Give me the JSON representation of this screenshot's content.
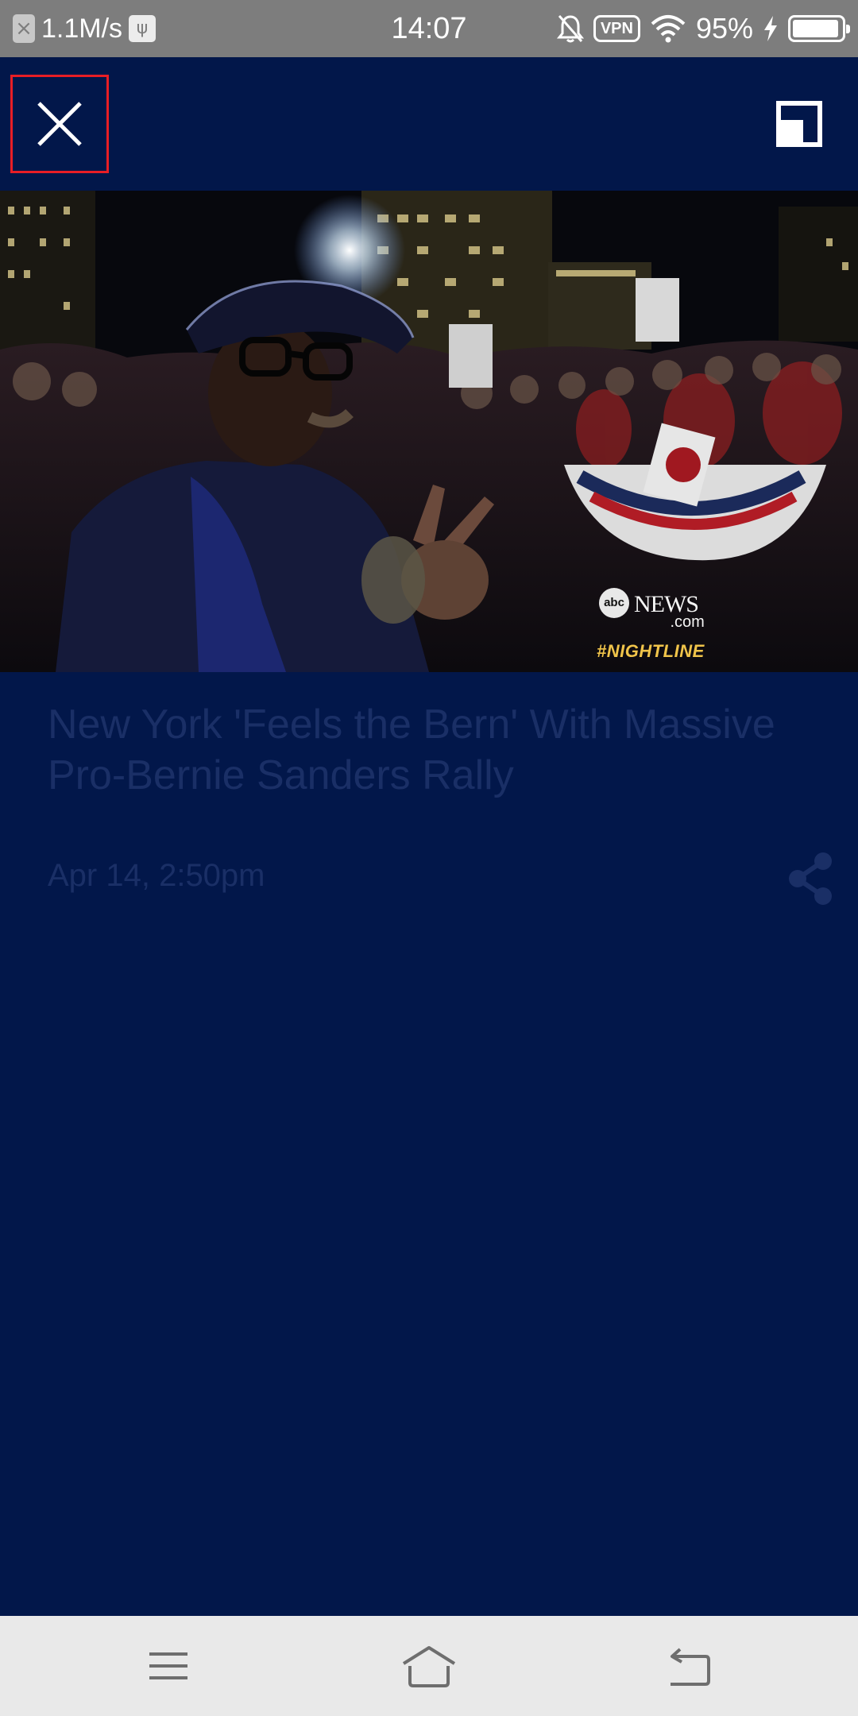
{
  "status_bar": {
    "notification_badge": "×",
    "network_speed": "1.1M/s",
    "usb_icon": "ψ",
    "time": "14:07",
    "vpn_label": "VPN",
    "battery_percent": "95%",
    "battery_level": 0.95,
    "icons": [
      "close-notification-icon",
      "usb-icon",
      "bell-muted-icon",
      "vpn-icon",
      "wifi-icon",
      "charging-bolt-icon",
      "battery-icon"
    ]
  },
  "toolbar": {
    "close_icon": "close-icon",
    "pip_icon": "picture-in-picture-icon",
    "highlight_color": "#e81e25"
  },
  "video": {
    "watermark_brand": "abc",
    "watermark_news": "NEWS",
    "watermark_domain": ".com",
    "watermark_tag": "#NIGHTLINE"
  },
  "article": {
    "title": "New York 'Feels the Bern' With Massive Pro-Bernie Sanders Rally",
    "date": "Apr 14, 2:50pm",
    "share_icon": "share-icon"
  },
  "nav_bar": {
    "icons": [
      "menu-icon",
      "home-icon",
      "back-icon"
    ]
  },
  "colors": {
    "background": "#02174a",
    "status_bar": "#7d7d7d",
    "muted_text": "#1a2f66",
    "nav_bar": "#e9e9e9"
  }
}
